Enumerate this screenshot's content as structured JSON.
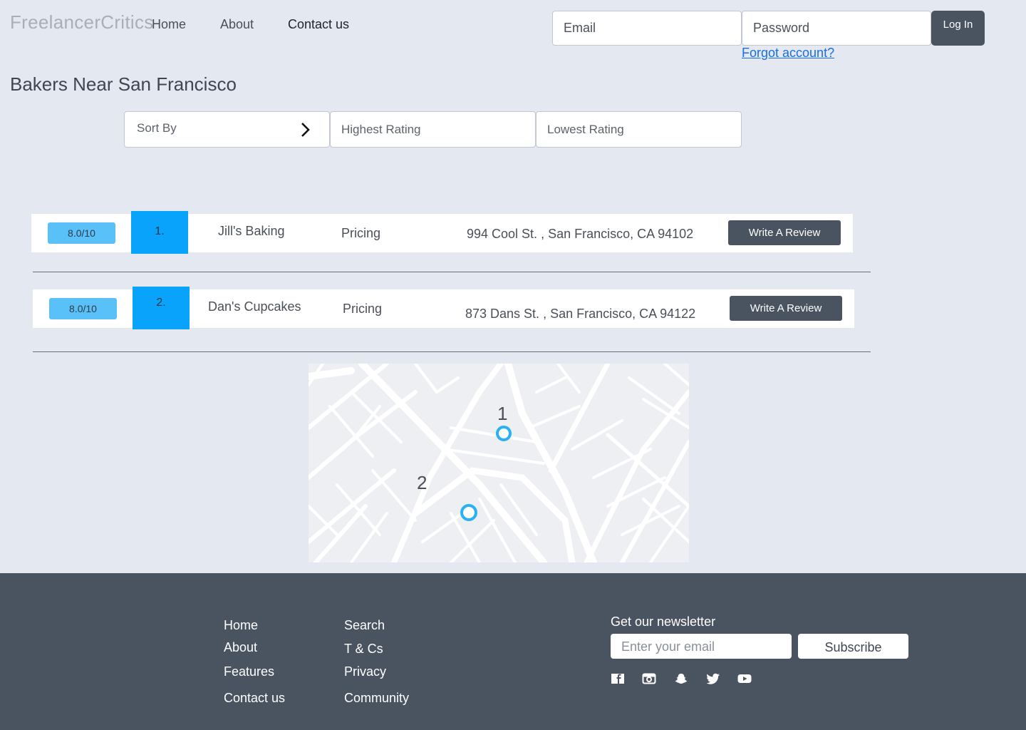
{
  "header": {
    "logo": "FreelancerCritics",
    "nav": [
      {
        "label": "Home"
      },
      {
        "label": "About"
      },
      {
        "label": "Contact us"
      }
    ],
    "email_placeholder": "Email",
    "password_placeholder": "Password",
    "login_label": "Log In",
    "forgot_label": "Forgot account?"
  },
  "page": {
    "title": "Bakers Near San Francisco"
  },
  "sort": {
    "label": "Sort By",
    "options": [
      "Highest Rating",
      "Lowest Rating"
    ]
  },
  "results": [
    {
      "rating": "8.0/10",
      "rank": "1.",
      "name": "Jill's Baking",
      "pricing": "Pricing",
      "address": "994 Cool St. , San Francisco, CA 94102",
      "action": "Write A Review"
    },
    {
      "rating": "8.0/10",
      "rank": "2.",
      "name": "Dan's Cupcakes",
      "pricing": "Pricing",
      "address": "873 Dans St. , San Francisco, CA 94122",
      "action": "Write A Review"
    }
  ],
  "map": {
    "markers": [
      {
        "label": "1"
      },
      {
        "label": "2"
      }
    ],
    "marker_color": "#29b1f6"
  },
  "footer": {
    "col1": [
      "Home",
      "About",
      "Features",
      "Contact us"
    ],
    "col2": [
      "Search",
      "T & Cs",
      "Privacy",
      "Community"
    ],
    "newsletter": {
      "title": "Get our newsletter",
      "placeholder": "Enter your email",
      "button": "Subscribe"
    },
    "social_icons": [
      "facebook-icon",
      "instagram-icon",
      "snapchat-icon",
      "twitter-icon",
      "youtube-icon"
    ]
  },
  "colors": {
    "background": "#e4e8f1",
    "dark": "#4a5360",
    "accent_blue": "#0aa3fb",
    "rating_blue": "#5ac0f8",
    "link": "#1a6fe0"
  }
}
